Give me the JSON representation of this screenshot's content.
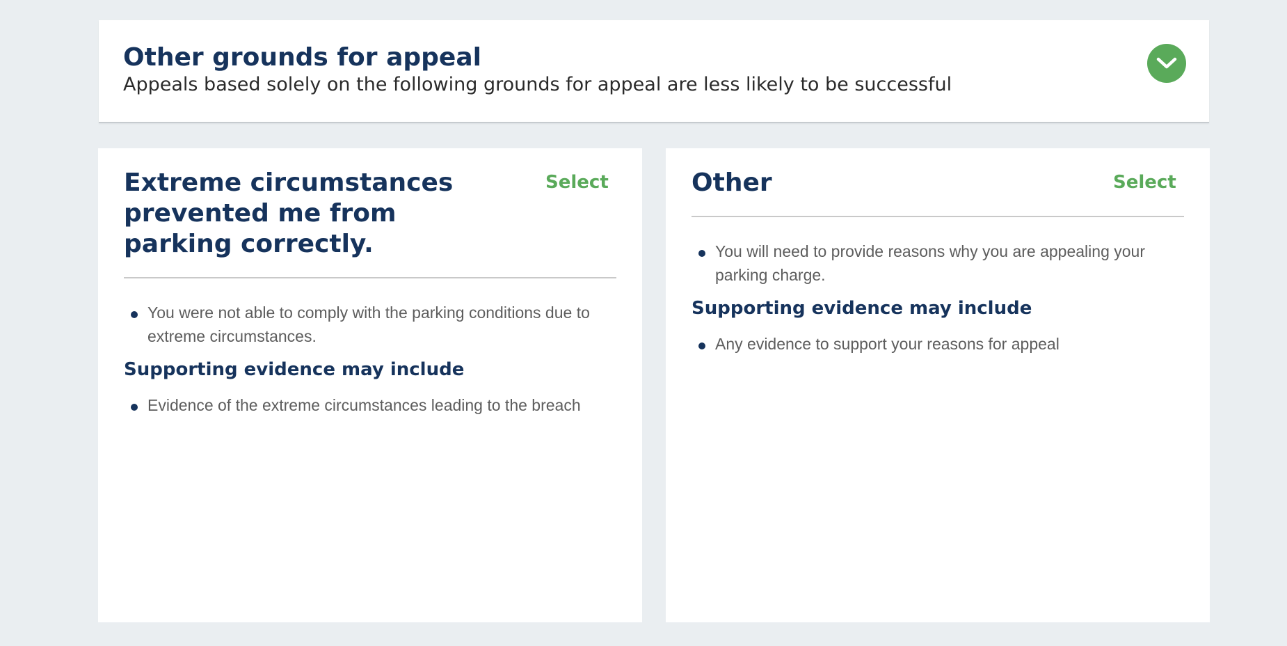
{
  "section": {
    "title": "Other grounds for appeal",
    "subtitle": "Appeals based solely on the following grounds for appeal are less likely to be successful",
    "toggle_icon": "chevron-down-icon"
  },
  "colors": {
    "background": "#eaeef1",
    "heading": "#16335c",
    "accent": "#5aaa5a",
    "body_text": "#5d5d5d"
  },
  "cards": [
    {
      "title": "Extreme circumstances prevented me from parking correctly.",
      "select_label": "Select",
      "description": [
        "You were not able to comply with the parking conditions due to extreme circumstances."
      ],
      "evidence_heading": "Supporting evidence may include",
      "evidence": [
        "Evidence of the extreme circumstances leading to the breach"
      ]
    },
    {
      "title": "Other",
      "select_label": "Select",
      "description": [
        "You will need to provide reasons why you are appealing your parking charge."
      ],
      "evidence_heading": "Supporting evidence may include",
      "evidence": [
        "Any evidence to support your reasons for appeal"
      ]
    }
  ]
}
